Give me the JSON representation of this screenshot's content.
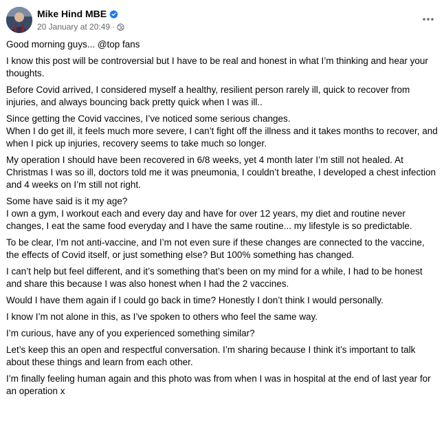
{
  "post": {
    "author": "Mike Hind MBE",
    "timestamp": "20 January at 20:49",
    "separator": "·",
    "audience_icon": "globe-icon",
    "verified_icon": "verified-badge-icon",
    "more_icon": "more-options-icon",
    "colors": {
      "text": "#050505",
      "secondary": "#65676b",
      "verified": "#1877f2"
    },
    "paragraphs": [
      {
        "lines": [
          "Good morning guys... @top fans"
        ]
      },
      {
        "lines": [
          "I know this post will be controversial but I have to be real and honest in what I’m thinking and hear your thoughts."
        ]
      },
      {
        "lines": [
          "Before Covid arrived, I considered myself a healthy, resilient person rarely ill, quick to recover from injuries, and always bouncing back pretty quick when I was ill.."
        ]
      },
      {
        "lines": [
          "Since getting the Covid vaccines, I’ve noticed some serious changes.",
          "When I do get ill, it feels much more severe, I can’t fight off the illness and it takes months to recover, and when I pick up injuries, recovery seems to take much so longer."
        ]
      },
      {
        "lines": [
          "My operation I should have been recovered in 6/8 weeks, yet 4 month later I’m still not healed. At Christmas I was so ill, doctors told me it was pneumonia, I couldn’t breathe, I developed a chest infection and 4 weeks on I’m still not right."
        ]
      },
      {
        "lines": [
          "Some have said is it my age?",
          "I own a gym, I workout each and every day and have for over 12 years, my diet and routine never changes, I eat the same food everyday and I have the same routine... my lifestyle is so predictable."
        ]
      },
      {
        "lines": [
          "To be clear, I’m not anti-vaccine, and I’m not even sure if these changes are connected to the vaccine, the effects of Covid itself, or just something else? But 100% something has changed."
        ]
      },
      {
        "lines": [
          "I can’t help but feel different, and it’s something that’s been on my mind for a while, I had to be honest and share this because I was also honest when I had the 2 vaccines."
        ]
      },
      {
        "lines": [
          "Would I have them again if I could go back in time? Honestly I don’t think I would personally."
        ]
      },
      {
        "lines": [
          "I know I’m not alone in this, as I’ve spoken to others who feel the same way."
        ]
      },
      {
        "lines": [
          "I’m curious, have any of you experienced something similar?"
        ]
      },
      {
        "lines": [
          "Let’s keep this an open and respectful conversation. I’m sharing because I think it’s important to talk about these things and learn from each other."
        ]
      },
      {
        "lines": [
          "I’m finally feeling human again and this photo was from when I was in hospital at the end of last year for an operation x"
        ]
      }
    ]
  }
}
